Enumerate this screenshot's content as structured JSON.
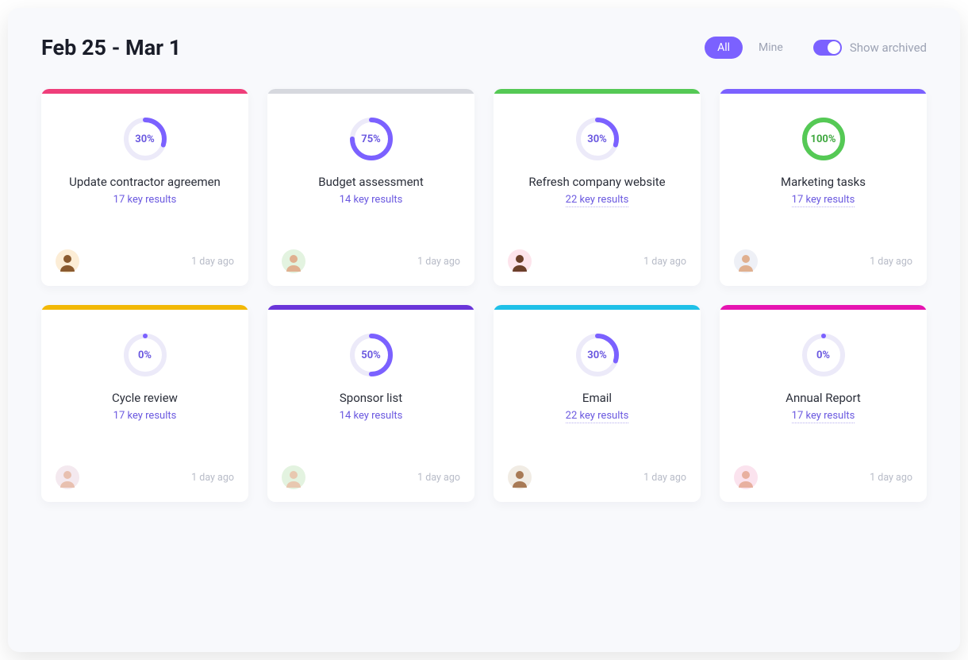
{
  "header": {
    "title": "Feb 25 - Mar 1",
    "filter_all": "All",
    "filter_mine": "Mine",
    "toggle_label": "Show archived"
  },
  "cards": [
    {
      "stripe_color": "#ef3e7a",
      "percent": 30,
      "pct_label": "30%",
      "ring_color": "#7b61ff",
      "pct_text_color": "#6b59e0",
      "title": "Update contractor agreemen",
      "key_results": "17 key results",
      "kr_dotted": false,
      "timestamp": "1 day ago",
      "avatar_bg": "#fcedd6",
      "avatar_face": "#8a5a2f"
    },
    {
      "stripe_color": "#d6d8de",
      "percent": 75,
      "pct_label": "75%",
      "ring_color": "#7b61ff",
      "pct_text_color": "#6b59e0",
      "title": "Budget assessment",
      "key_results": "14 key results",
      "kr_dotted": false,
      "timestamp": "1 day ago",
      "avatar_bg": "#e3f3e0",
      "avatar_face": "#e0b090"
    },
    {
      "stripe_color": "#55c955",
      "percent": 30,
      "pct_label": "30%",
      "ring_color": "#7b61ff",
      "pct_text_color": "#6b59e0",
      "title": "Refresh company website",
      "key_results": "22 key results",
      "kr_dotted": true,
      "timestamp": "1 day ago",
      "avatar_bg": "#fde4ec",
      "avatar_face": "#6b3f2a"
    },
    {
      "stripe_color": "#7b61ff",
      "percent": 100,
      "pct_label": "100%",
      "ring_color": "#55c955",
      "pct_text_color": "#3fa83f",
      "title": "Marketing tasks",
      "key_results": "17 key results",
      "kr_dotted": true,
      "timestamp": "1 day ago",
      "avatar_bg": "#eef0f6",
      "avatar_face": "#e0b090"
    },
    {
      "stripe_color": "#f2b807",
      "percent": 0,
      "pct_label": "0%",
      "ring_color": "#7b61ff",
      "pct_text_color": "#6b59e0",
      "title": "Cycle review",
      "key_results": "17 key results",
      "kr_dotted": false,
      "timestamp": "1 day ago",
      "avatar_bg": "#f4e9ef",
      "avatar_face": "#e8c0b0"
    },
    {
      "stripe_color": "#6a35d9",
      "percent": 50,
      "pct_label": "50%",
      "ring_color": "#7b61ff",
      "pct_text_color": "#6b59e0",
      "title": "Sponsor list",
      "key_results": "14 key results",
      "kr_dotted": false,
      "timestamp": "1 day ago",
      "avatar_bg": "#e3f3e0",
      "avatar_face": "#e8c8b0"
    },
    {
      "stripe_color": "#1fc0e8",
      "percent": 30,
      "pct_label": "30%",
      "ring_color": "#7b61ff",
      "pct_text_color": "#6b59e0",
      "title": "Email",
      "key_results": "22 key results",
      "kr_dotted": true,
      "timestamp": "1 day ago",
      "avatar_bg": "#f1ece4",
      "avatar_face": "#a87a55"
    },
    {
      "stripe_color": "#e614b1",
      "percent": 0,
      "pct_label": "0%",
      "ring_color": "#7b61ff",
      "pct_text_color": "#6b59e0",
      "title": "Annual Report",
      "key_results": "17 key results",
      "kr_dotted": true,
      "timestamp": "1 day ago",
      "avatar_bg": "#fbe3ee",
      "avatar_face": "#e8b0a0"
    }
  ]
}
